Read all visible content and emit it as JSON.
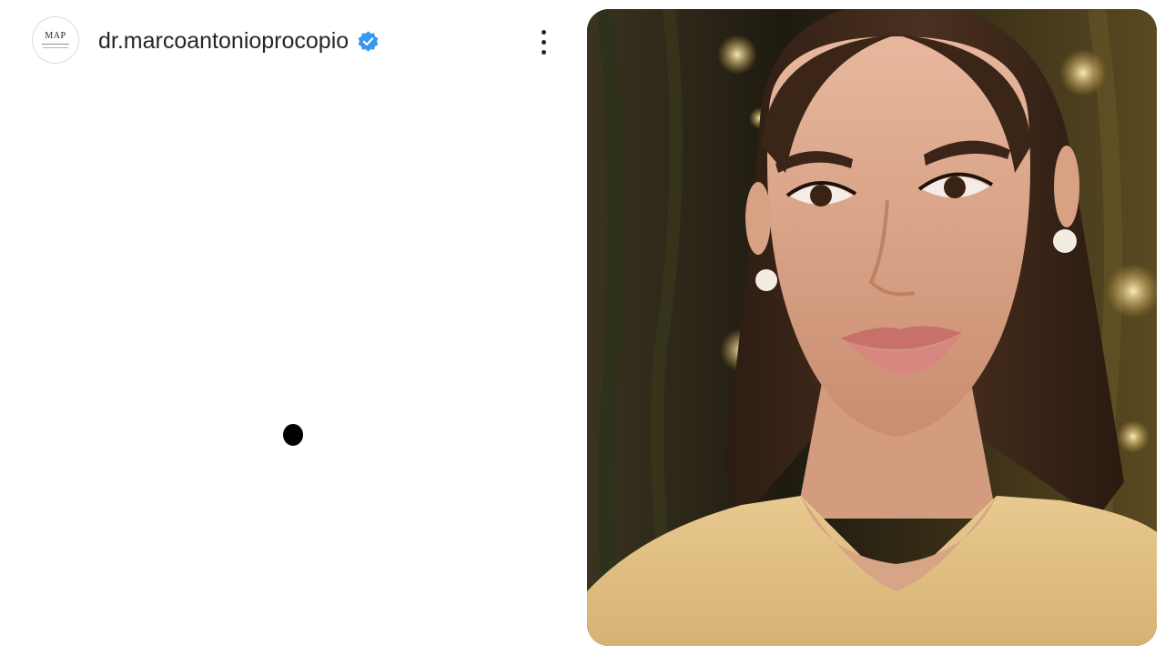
{
  "post": {
    "account": {
      "username": "dr.marcoantonioprocopio",
      "avatar_text": "MAP",
      "verified": true,
      "verified_icon": "verified-badge-icon",
      "verified_color": "#3897f0"
    },
    "menu_icon": "more-vertical-icon",
    "loading_indicator": "loading-dot",
    "photo": {
      "subject": "portrait-photo",
      "background_color": "#2a2516"
    }
  }
}
